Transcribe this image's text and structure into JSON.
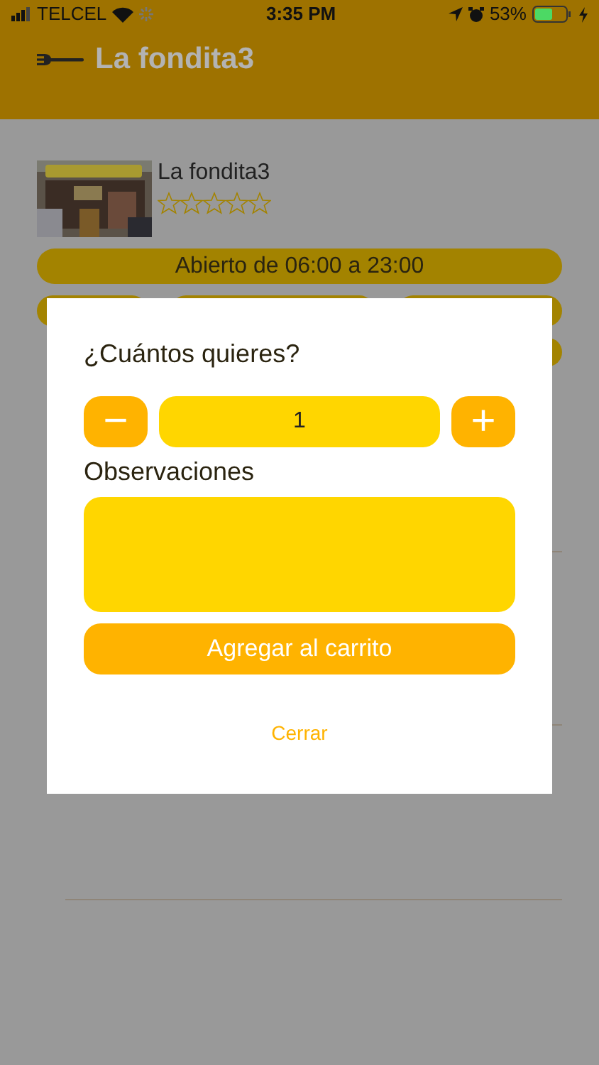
{
  "status_bar": {
    "carrier": "TELCEL",
    "time": "3:35 PM",
    "battery": "53%"
  },
  "header": {
    "title": "La fondita3"
  },
  "restaurant": {
    "name": "La fondita3",
    "stars": 0,
    "hours": "Abierto de 06:00 a 23:00"
  },
  "dialog": {
    "title": "¿Cuántos quieres?",
    "minus": "−",
    "quantity": "1",
    "plus": "+",
    "notes_label": "Observaciones",
    "add_button": "Agregar al carrito",
    "close_button": "Cerrar"
  }
}
